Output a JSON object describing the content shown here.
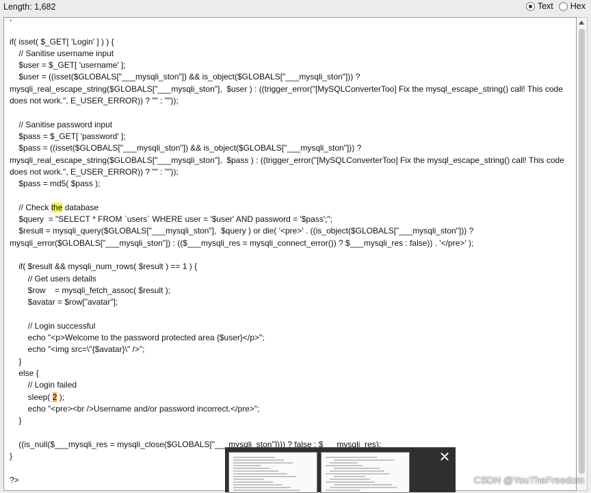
{
  "header": {
    "length_label": "Length: 1,682",
    "view_options": [
      {
        "label": "Text",
        "checked": true
      },
      {
        "label": "Hex",
        "checked": false
      }
    ]
  },
  "code": {
    "lines": [
      ",",
      "",
      "if( isset( $_GET[ 'Login' ] ) ) {",
      "    // Sanitise username input",
      "    $user = $_GET[ 'username' ];",
      "    $user = ((isset($GLOBALS[\"___mysqli_ston\"]) && is_object($GLOBALS[\"___mysqli_ston\"])) ? mysqli_real_escape_string($GLOBALS[\"___mysqli_ston\"],  $user ) : ((trigger_error(\"[MySQLConverterToo] Fix the mysql_escape_string() call! This code does not work.\", E_USER_ERROR)) ? \"\" : \"\"));",
      "",
      "    // Sanitise password input",
      "    $pass = $_GET[ 'password' ];",
      "    $pass = ((isset($GLOBALS[\"___mysqli_ston\"]) && is_object($GLOBALS[\"___mysqli_ston\"])) ? mysqli_real_escape_string($GLOBALS[\"___mysqli_ston\"],  $pass ) : ((trigger_error(\"[MySQLConverterToo] Fix the mysql_escape_string() call! This code does not work.\", E_USER_ERROR)) ? \"\" : \"\"));",
      "    $pass = md5( $pass );",
      "",
      "    // Check the database",
      "    $query  = \"SELECT * FROM `users` WHERE user = '$user' AND password = '$pass';\";",
      "    $result = mysqli_query($GLOBALS[\"___mysqli_ston\"],  $query ) or die( '<pre>' . ((is_object($GLOBALS[\"___mysqli_ston\"])) ? mysqli_error($GLOBALS[\"___mysqli_ston\"]) : (($___mysqli_res = mysqli_connect_error()) ? $___mysqli_res : false)) . '</pre>' );",
      "",
      "    if( $result && mysqli_num_rows( $result ) == 1 ) {",
      "        // Get users details",
      "        $row    = mysqli_fetch_assoc( $result );",
      "        $avatar = $row[\"avatar\"];",
      "",
      "        // Login successful",
      "        echo \"<p>Welcome to the password protected area {$user}</p>\";",
      "        echo \"<img src=\\\"{$avatar}\\\" />\";",
      "    }",
      "    else {",
      "        // Login failed",
      "        sleep( 2 );",
      "        echo \"<pre><br />Username and/or password incorrect.</pre>\";",
      "    }",
      "",
      "    ((is_null($___mysqli_res = mysqli_close($GLOBALS[\"___mysqli_ston\"]))) ? false : $___mysqli_res);",
      "}",
      "",
      "?>"
    ],
    "highlights": [
      {
        "line": 12,
        "text": "the",
        "color": "#f5ef43"
      },
      {
        "line": 27,
        "text": "2",
        "color": "#f4a95a"
      }
    ]
  },
  "popup": {
    "close_symbol": "✕"
  },
  "watermark": "CSDN @YouTheFreedom"
}
